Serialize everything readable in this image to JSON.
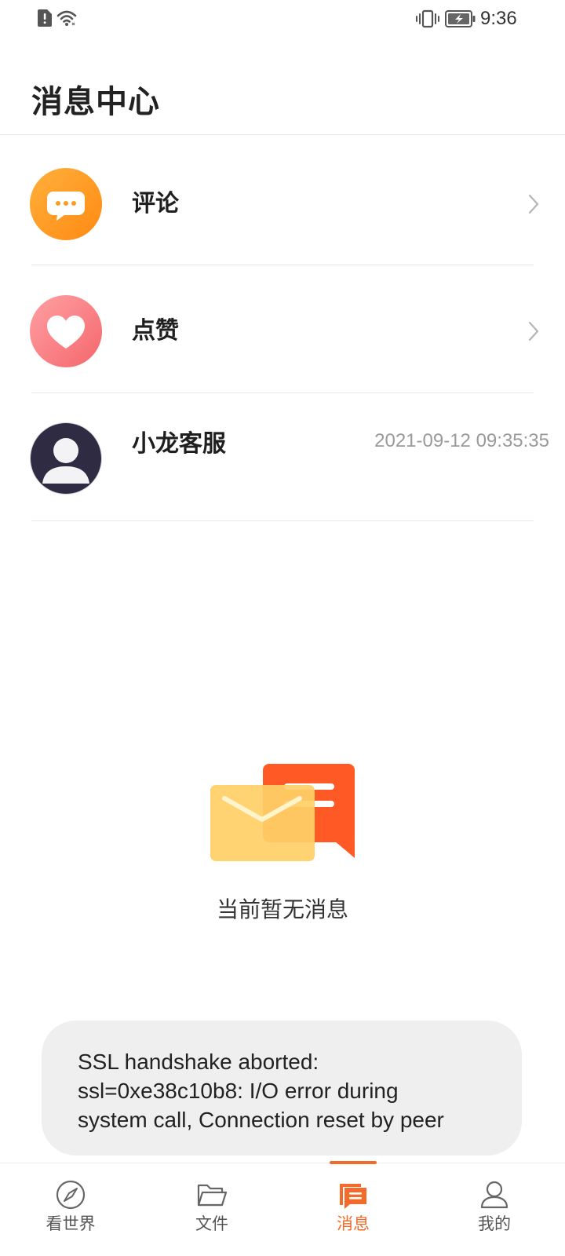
{
  "status_bar": {
    "time": "9:36",
    "icons": [
      "sim-alert-icon",
      "wifi-icon",
      "vibrate-icon",
      "battery-charging-icon"
    ]
  },
  "header": {
    "title": "消息中心"
  },
  "messages": [
    {
      "label": "评论",
      "icon": "comment-icon",
      "has_chevron": true
    },
    {
      "label": "点赞",
      "icon": "heart-icon",
      "has_chevron": true
    },
    {
      "label": "小龙客服",
      "icon": "customer-service-avatar",
      "time": "2021-09-12 09:35:35"
    }
  ],
  "empty_state": {
    "text": "当前暂无消息",
    "icon": "mail-message-illustration"
  },
  "toast": {
    "lines": [
      "SSL handshake aborted:",
      "ssl=0xe38c10b8: I/O error during",
      "system call, Connection reset by peer"
    ]
  },
  "tab_bar": {
    "active_index": 2,
    "tabs": [
      {
        "label": "看世界",
        "icon": "compass-icon"
      },
      {
        "label": "文件",
        "icon": "folder-icon"
      },
      {
        "label": "消息",
        "icon": "message-icon"
      },
      {
        "label": "我的",
        "icon": "profile-icon"
      }
    ]
  },
  "colors": {
    "accent": "#f26b2a",
    "comment_icon": "#ff9a20",
    "like_icon": "#f97a7e",
    "avatar_bg": "#2e2b42",
    "toast_bg": "#efefef",
    "muted_text": "#9a9a9a"
  }
}
